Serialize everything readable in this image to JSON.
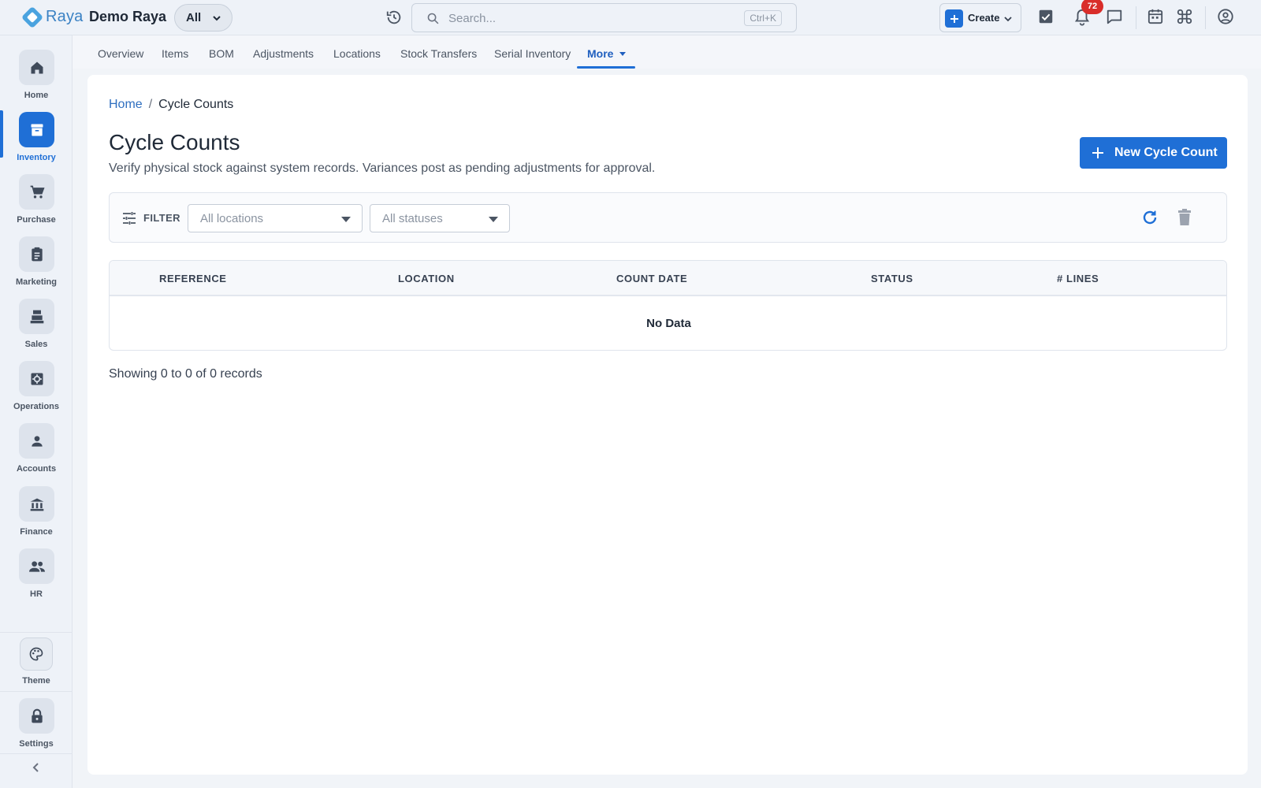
{
  "header": {
    "brand": "Raya",
    "company": "Demo Raya",
    "scope": "All",
    "search_placeholder": "Search...",
    "search_shortcut": "Ctrl+K",
    "create_label": "Create",
    "notification_count": "72"
  },
  "sidebar": {
    "items": [
      {
        "label": "Home",
        "icon": "home-icon"
      },
      {
        "label": "Inventory",
        "icon": "inventory-icon"
      },
      {
        "label": "Purchase",
        "icon": "cart-icon"
      },
      {
        "label": "Marketing",
        "icon": "clipboard-icon"
      },
      {
        "label": "Sales",
        "icon": "register-icon"
      },
      {
        "label": "Operations",
        "icon": "gear-box-icon"
      },
      {
        "label": "Accounts",
        "icon": "person-icon"
      },
      {
        "label": "Finance",
        "icon": "bank-icon"
      },
      {
        "label": "HR",
        "icon": "people-icon"
      }
    ],
    "bottom": [
      {
        "label": "Theme",
        "icon": "palette-icon"
      },
      {
        "label": "Settings",
        "icon": "lock-icon"
      }
    ],
    "active": "Inventory"
  },
  "tabs": [
    "Overview",
    "Items",
    "BOM",
    "Adjustments",
    "Locations",
    "Stock Transfers",
    "Serial Inventory",
    "More"
  ],
  "breadcrumb": {
    "home": "Home",
    "current": "Cycle Counts"
  },
  "page": {
    "title": "Cycle Counts",
    "subtitle": "Verify physical stock against system records. Variances post as pending adjustments for approval.",
    "primary_button": "New Cycle Count"
  },
  "filter": {
    "label": "FILTER",
    "location_value": "All locations",
    "status_value": "All statuses"
  },
  "table": {
    "columns": [
      "REFERENCE",
      "LOCATION",
      "COUNT DATE",
      "STATUS",
      "# LINES"
    ],
    "empty_text": "No Data"
  },
  "records_text": "Showing 0 to 0 of 0 records",
  "colors": {
    "accent": "#1f6fd6",
    "badge": "#d92d2a",
    "link": "#2f6fc0"
  }
}
